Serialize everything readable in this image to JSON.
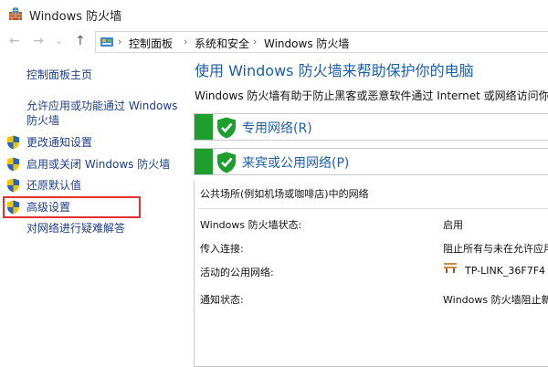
{
  "window": {
    "title": "Windows 防火墙"
  },
  "navigation": {
    "back": "←",
    "forward": "→",
    "recent": "⌄",
    "up": "↑",
    "breadcrumbs": [
      "控制面板",
      "系统和安全",
      "Windows 防火墙"
    ],
    "separator": "›"
  },
  "sidebar": {
    "home_link": "控制面板主页",
    "allow_app_link_line1": "允许应用或功能通过 Windows",
    "allow_app_link_line2": "防火墙",
    "items": [
      "更改通知设置",
      "启用或关闭 Windows 防火墙",
      "还原默认值",
      "高级设置"
    ],
    "troubleshoot_link": "对网络进行疑难解答"
  },
  "main": {
    "title": "使用 Windows 防火墙来帮助保护你的电脑",
    "description": "Windows 防火墙有助于防止黑客或恶意软件通过 Internet 或网络访问你的电"
  },
  "panels": {
    "private": {
      "title": "专用网络(R)"
    },
    "public": {
      "title": "来宾或公用网络(P)",
      "description": "公共场所(例如机场或咖啡店)中的网络",
      "rows": [
        {
          "label": "Windows 防火墙状态:",
          "value": "启用"
        },
        {
          "label": "传入连接:",
          "value": "阻止所有与未在允许应用"
        },
        {
          "label": "活动的公用网络:",
          "value": "TP-LINK_36F7F4"
        },
        {
          "label": "通知状态:",
          "value": "Windows 防火墙阻止新"
        }
      ]
    }
  },
  "colors": {
    "link": "#1d3e8a",
    "heading": "#1e5ea8",
    "status_green": "#1e9e2c",
    "highlight_red": "#e43131"
  },
  "icons": {
    "app": "firewall-icon",
    "shield": "uac-shield-icon",
    "check": "green-check-shield-icon",
    "network": "network-bench-icon"
  }
}
